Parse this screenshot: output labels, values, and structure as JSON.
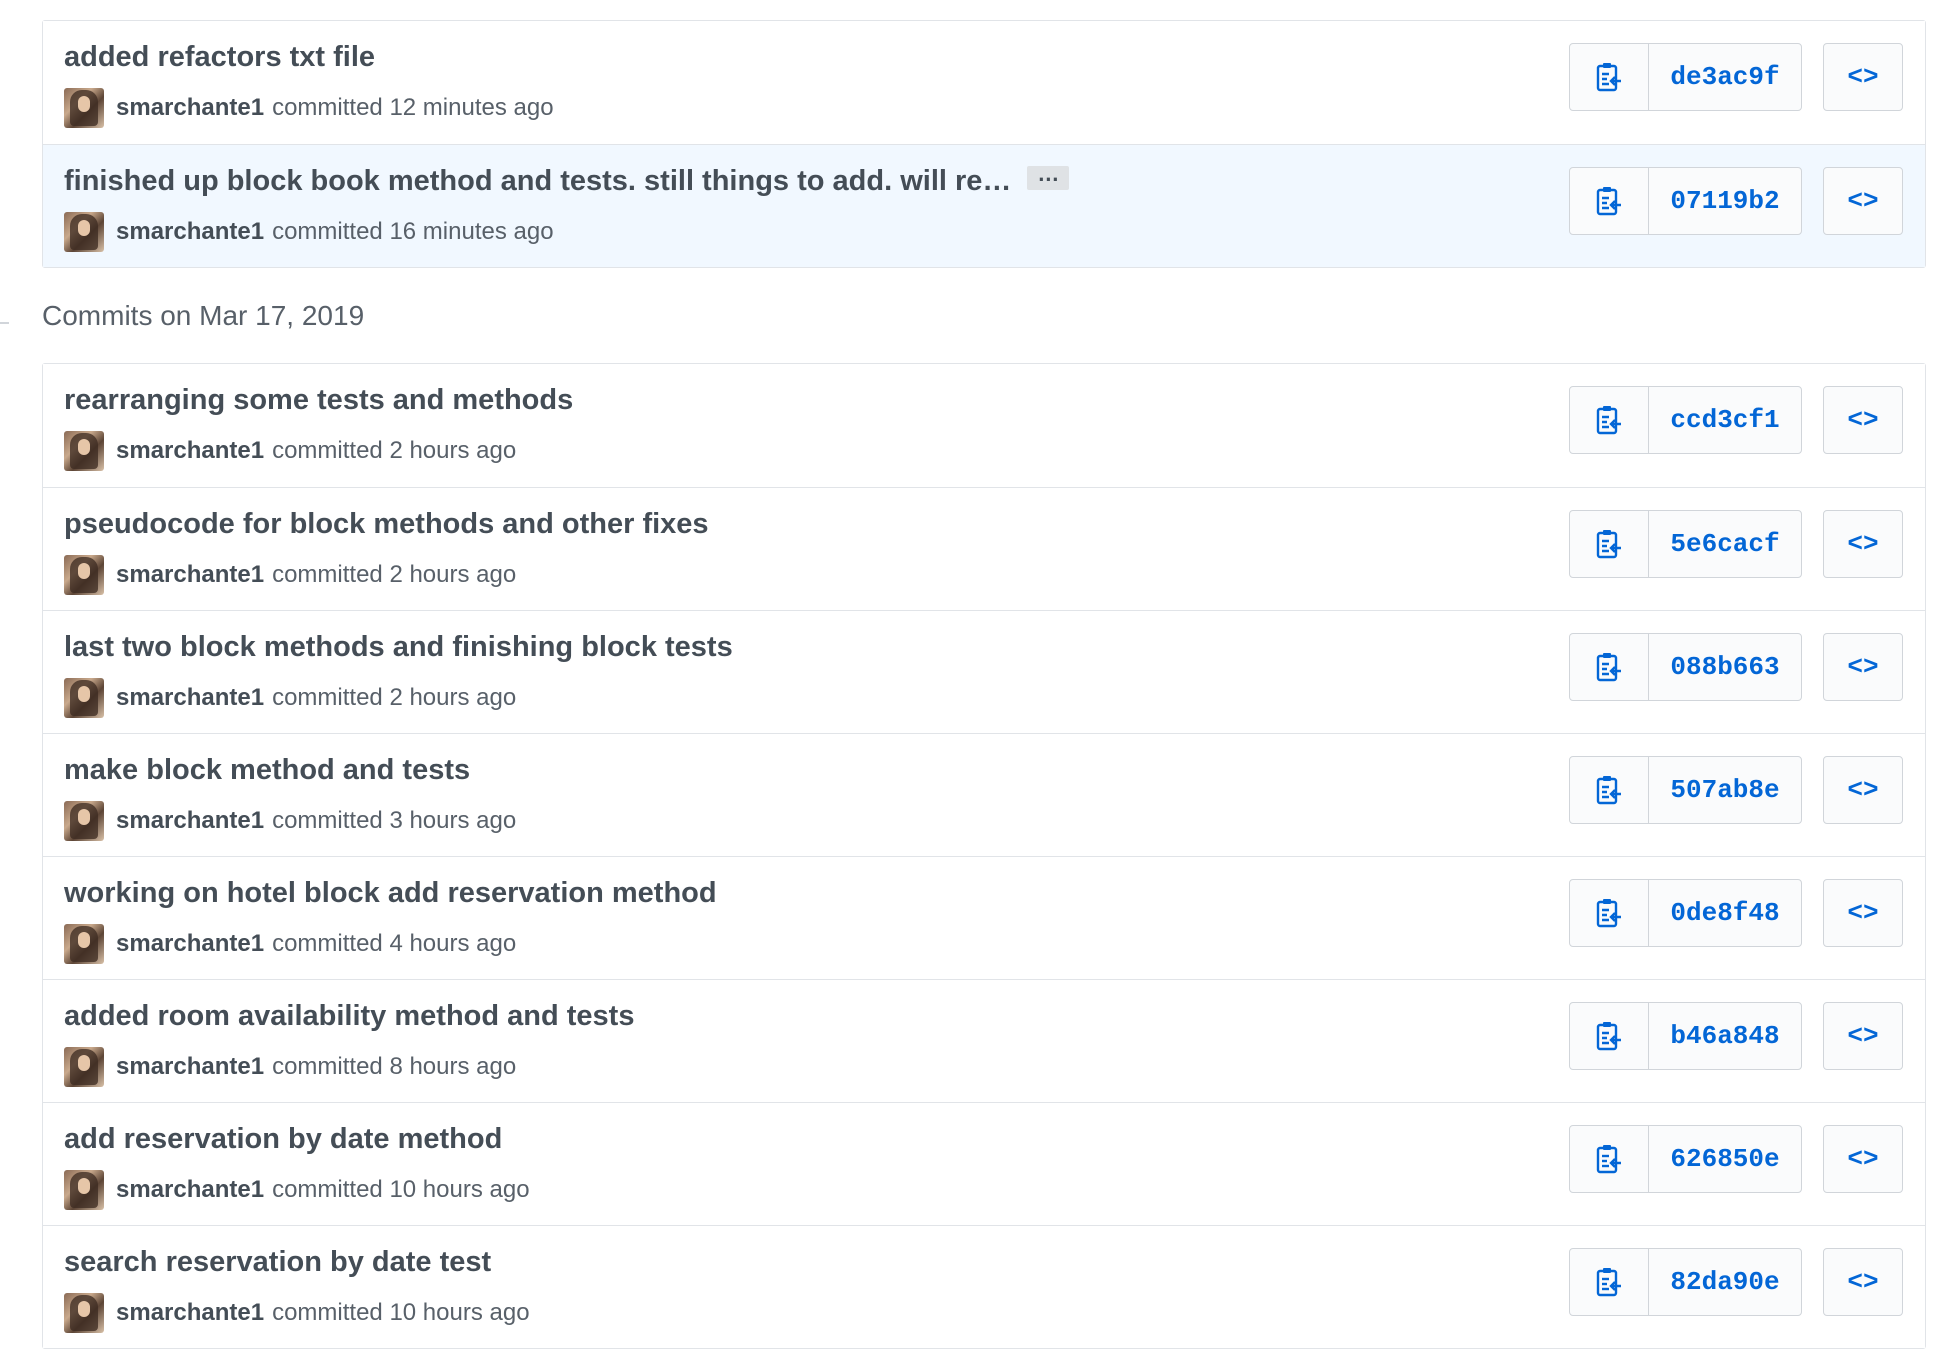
{
  "group_heading": "Commits on Mar 17, 2019",
  "ellipsis_label": "…",
  "browse_label": "<>",
  "icons": {
    "copy": "clipboard-copy-icon",
    "browse": "code-brackets-icon"
  },
  "colors": {
    "link": "#0366d6",
    "highlight_row": "#f1f8ff",
    "border": "#e1e4e8"
  },
  "commits_top": [
    {
      "title": "added refactors txt file",
      "author": "smarchante1",
      "time": "committed 12 minutes ago",
      "sha": "de3ac9f"
    },
    {
      "title": "finished up block book method and tests. still things to add. will re…",
      "author": "smarchante1",
      "time": "committed 16 minutes ago",
      "sha": "07119b2"
    }
  ],
  "commits_mar17": [
    {
      "title": "rearranging some tests and methods",
      "author": "smarchante1",
      "time": "committed 2 hours ago",
      "sha": "ccd3cf1"
    },
    {
      "title": "pseudocode for block methods and other fixes",
      "author": "smarchante1",
      "time": "committed 2 hours ago",
      "sha": "5e6cacf"
    },
    {
      "title": "last two block methods and finishing block tests",
      "author": "smarchante1",
      "time": "committed 2 hours ago",
      "sha": "088b663"
    },
    {
      "title": "make block method and tests",
      "author": "smarchante1",
      "time": "committed 3 hours ago",
      "sha": "507ab8e"
    },
    {
      "title": "working on hotel block add reservation method",
      "author": "smarchante1",
      "time": "committed 4 hours ago",
      "sha": "0de8f48"
    },
    {
      "title": "added room availability method and tests",
      "author": "smarchante1",
      "time": "committed 8 hours ago",
      "sha": "b46a848"
    },
    {
      "title": "add reservation by date method",
      "author": "smarchante1",
      "time": "committed 10 hours ago",
      "sha": "626850e"
    },
    {
      "title": "search reservation by date test",
      "author": "smarchante1",
      "time": "committed 10 hours ago",
      "sha": "82da90e"
    }
  ]
}
